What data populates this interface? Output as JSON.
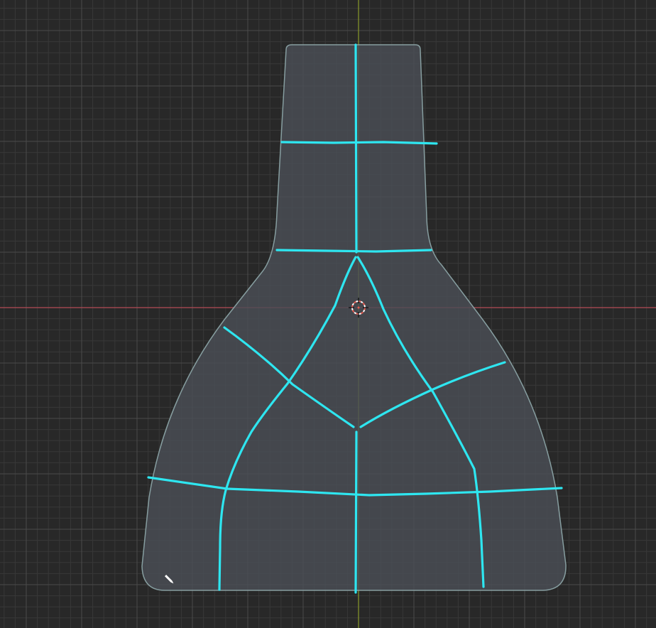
{
  "viewport": {
    "background": "#282828",
    "grid_minor_color": "#383838",
    "grid_major_color": "#4a4a4a",
    "axis_x_color": "#b34b56",
    "axis_y_color": "#8a9a2a"
  },
  "mesh": {
    "fill": "#4b4e55",
    "outline": "#8fa8ab",
    "stroke_color": "#2ee6f0"
  },
  "cursor": {
    "icon": "3d-cursor-icon",
    "color": "#e45a4f"
  },
  "tool": {
    "icon": "pencil-icon",
    "color": "#ffffff"
  }
}
